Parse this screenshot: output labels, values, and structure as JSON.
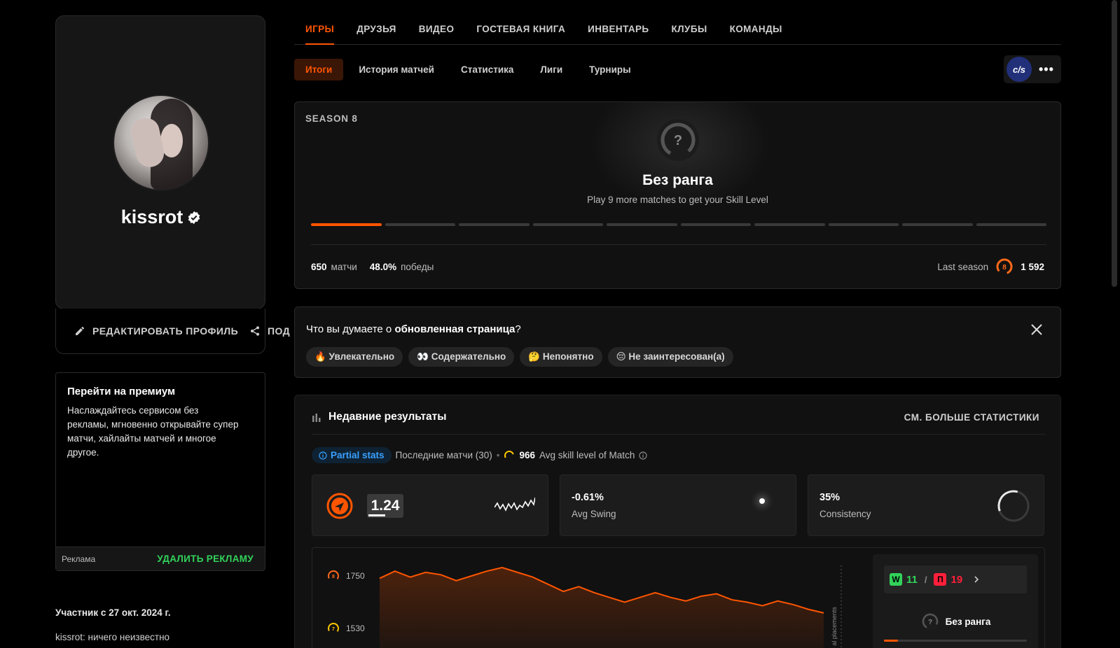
{
  "profile": {
    "nickname": "kissrot",
    "edit_label": "РЕДАКТИРОВАТЬ ПРОФИЛЬ",
    "share_label": "ПОД",
    "member_since": "Участник с 27 окт. 2024 г.",
    "bio": "kissrot: ничего неизвестно"
  },
  "premium": {
    "title": "Перейти на премиум",
    "text": "Наслаждайтесь сервисом без рекламы, мгновенно открывайте супер матчи, хайлайты матчей и многое другое.",
    "ad_label": "Реклама",
    "remove_ad_label": "УДАЛИТЬ РЕКЛАМУ"
  },
  "main_tabs": [
    {
      "label": "ИГРЫ",
      "active": true
    },
    {
      "label": "ДРУЗЬЯ"
    },
    {
      "label": "ВИДЕО"
    },
    {
      "label": "ГОСТЕВАЯ КНИГА"
    },
    {
      "label": "ИНВЕНТАРЬ"
    },
    {
      "label": "КЛУБЫ"
    },
    {
      "label": "КОМАНДЫ"
    }
  ],
  "sub_tabs": [
    {
      "label": "Итоги",
      "active": true
    },
    {
      "label": "История матчей"
    },
    {
      "label": "Статистика"
    },
    {
      "label": "Лиги"
    },
    {
      "label": "Турниры"
    }
  ],
  "game_switch": {
    "game_label": "c/s",
    "more_label": "•••"
  },
  "season": {
    "label": "SEASON 8",
    "rank_symbol": "?",
    "rank_title": "Без ранга",
    "rank_subtitle": "Play 9 more matches to get your Skill Level",
    "progress_segments": 10,
    "progress_filled": 1,
    "matches_value": "650",
    "matches_label": "матчи",
    "winrate_value": "48.0%",
    "winrate_label": "победы",
    "last_season_label": "Last season",
    "last_season_level": "8",
    "last_season_elo": "1 592"
  },
  "feedback": {
    "question_prefix": "Что вы думаете о ",
    "question_bold": "обновленная страница",
    "question_suffix": "?",
    "options": [
      "🔥 Увлекательно",
      "👀 Содержательно",
      "🤔 Непонятно",
      "😔 Не заинтересован(а)"
    ]
  },
  "recent": {
    "title": "Недавние результаты",
    "more_stats": "СМ. БОЛЬШЕ СТАТИСТИКИ",
    "partial_label": "Partial stats",
    "recent_matches": "Последние матчи (30)",
    "separator": "•",
    "avg_level_value": "966",
    "avg_level_label": "Avg skill level of Match",
    "rating_value": "1.24",
    "swing_value": "-0.61%",
    "swing_label": "Avg Swing",
    "consistency_value": "35%",
    "consistency_label": "Consistency",
    "wins": "11",
    "losses": "19",
    "w_letter": "W",
    "l_letter": "П",
    "slash": "/",
    "rank_title": "Без ранга",
    "rank_progress": 0.1
  },
  "chart_data": {
    "type": "area",
    "y_ticks": [
      {
        "level": "8",
        "value": 1750
      },
      {
        "level": "7",
        "value": 1530
      }
    ],
    "values": [
      1740,
      1770,
      1745,
      1765,
      1755,
      1730,
      1750,
      1770,
      1785,
      1765,
      1745,
      1715,
      1685,
      1705,
      1680,
      1660,
      1640,
      1660,
      1680,
      1660,
      1645,
      1665,
      1675,
      1650,
      1640,
      1625,
      1645,
      1630,
      1610,
      1595
    ],
    "annotation": "reset + al placements",
    "color": "#ff5500"
  },
  "colors": {
    "accent": "#ff5500",
    "win": "#32d35a",
    "loss": "#ff1f3a",
    "info": "#3aa0ff"
  }
}
